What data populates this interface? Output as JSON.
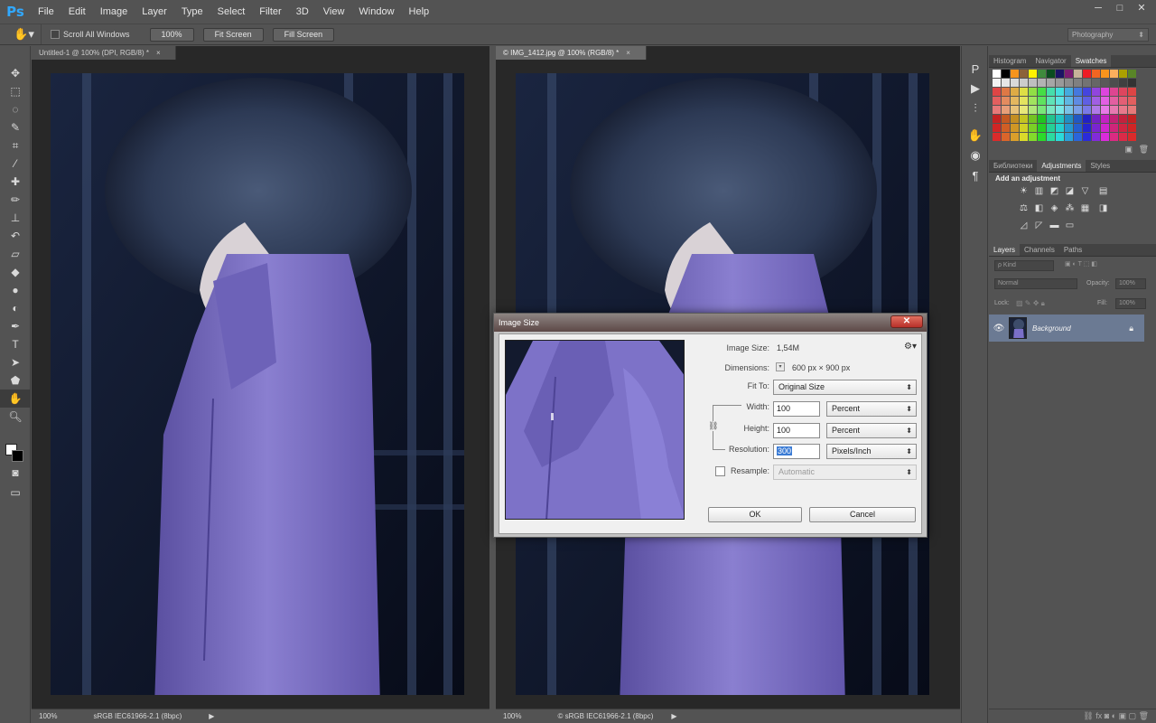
{
  "app": {
    "logo": "Ps"
  },
  "menu": [
    "File",
    "Edit",
    "Image",
    "Layer",
    "Type",
    "Select",
    "Filter",
    "3D",
    "View",
    "Window",
    "Help"
  ],
  "window_controls": [
    "─",
    "□",
    "✕"
  ],
  "options_bar": {
    "scroll_all_windows": "Scroll All Windows",
    "btn_100": "100%",
    "btn_fit_screen": "Fit Screen",
    "btn_fill_screen": "Fill Screen",
    "workspace": "Photography"
  },
  "documents": [
    {
      "tab": "Untitled-1 @ 100% (DPI, RGB/8) *",
      "zoom": "100%",
      "profile": "sRGB IEC61966-2.1 (8bpc)"
    },
    {
      "tab": "© IMG_1412.jpg @ 100% (RGB/8) *",
      "zoom": "100%",
      "profile": "© sRGB IEC61966-2.1 (8bpc)"
    }
  ],
  "panels": {
    "swatch_tabs": [
      "Histogram",
      "Navigator",
      "Swatches"
    ],
    "adjust_tabs": [
      "Библиотеки",
      "Adjustments",
      "Styles"
    ],
    "adjust_title": "Add an adjustment",
    "layer_tabs": [
      "Layers",
      "Channels",
      "Paths"
    ],
    "kind": "ρ Kind",
    "blend_mode": "Normal",
    "opacity_label": "Opacity:",
    "opacity_value": "100%",
    "lock_label": "Lock:",
    "fill_label": "Fill:",
    "fill_value": "100%",
    "layer_name": "Background"
  },
  "dialog": {
    "title": "Image Size",
    "close": "✕",
    "image_size_label": "Image Size:",
    "image_size_value": "1,54M",
    "dimensions_label": "Dimensions:",
    "dimensions_value": "600 px  ×  900 px",
    "fit_to_label": "Fit To:",
    "fit_to_value": "Original Size",
    "width_label": "Width:",
    "width_value": "100",
    "width_unit": "Percent",
    "height_label": "Height:",
    "height_value": "100",
    "height_unit": "Percent",
    "resolution_label": "Resolution:",
    "resolution_value": "300",
    "resolution_unit": "Pixels/Inch",
    "resample_label": "Resample:",
    "resample_value": "Automatic",
    "ok": "OK",
    "cancel": "Cancel"
  }
}
